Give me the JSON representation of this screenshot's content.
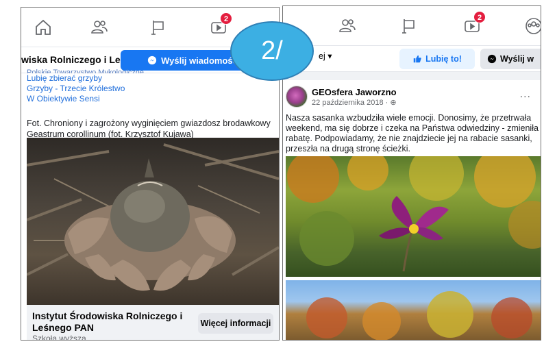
{
  "left_panel": {
    "nav": {
      "icons": [
        "home-icon",
        "friends-icon",
        "flag-icon",
        "watch-icon"
      ],
      "watch_badge": "2"
    },
    "action_bar": {
      "page_title_truncated": "wiska Rolniczego i Le...",
      "message_button_label": "Wyślij wiadomość"
    },
    "sponsored_links": {
      "cut_line": "Polskie Towarzystwo Mykologiczne",
      "items": [
        "Lubię zbierać grzyby",
        "Grzyby - Trzecie Królestwo",
        "W Obiektywie Sensi"
      ]
    },
    "post_description": "Fot. Chroniony i zagrożony wyginięciem gwiazdosz brodawkowy Geastrum corollinum (fot. Krzysztof Kujawa)",
    "card": {
      "org_name": "Instytut Środowiska Rolniczego i Leśnego PAN",
      "org_type": "Szkoła wyższa",
      "more_info_button": "Więcej informacji"
    }
  },
  "right_panel": {
    "nav": {
      "icons": [
        "friends-icon",
        "flag-icon",
        "watch-icon",
        "groups-icon"
      ],
      "watch_badge": "2"
    },
    "action_bar": {
      "follow_truncated": "ej ▾",
      "like_button": "Lubię to!",
      "message_button_truncated": "Wyślij w"
    },
    "post": {
      "author": "GEOsfera Jaworzno",
      "date": "22 października 2018 · ",
      "text": "Nasza sasanka wzbudziła wiele emocji. Donosimy, że przetrwała weekend, ma się dobrze i czeka na Państwa odwiedziny - zmieniła rabatę. Podpowiadamy, że nie znajdziecie jej na rabacie sasanki, przeszła na drugą stronę ścieżki.",
      "more_label": "..."
    }
  },
  "overlay": {
    "counter": "2/",
    "color": "#3cafe3"
  },
  "colors": {
    "facebook_blue": "#1877f2",
    "badge_red": "#e41e3f",
    "link_blue": "#216fdb"
  }
}
